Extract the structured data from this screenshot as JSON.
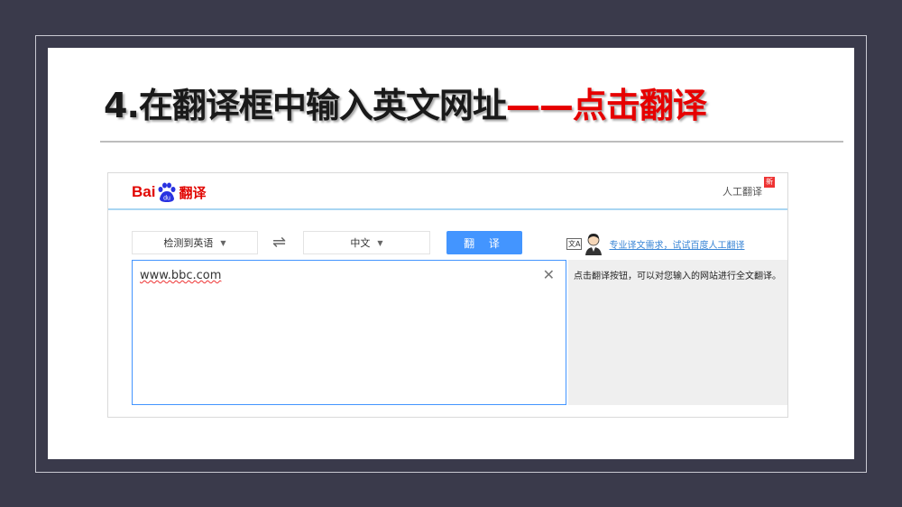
{
  "slide": {
    "title_part1": "4.在翻译框中输入英文网址",
    "title_part2": "——点击翻译"
  },
  "app": {
    "logo_text_bai": "Bai",
    "logo_text_du": "du",
    "logo_text_fanyi": "翻译",
    "human_translation_label": "人工翻译",
    "new_badge": "新",
    "source_lang": "检测到英语",
    "target_lang": "中文",
    "swap_symbol": "⇌",
    "translate_button": "翻 译",
    "input_value": "www.bbc.com",
    "clear_symbol": "✕",
    "promo_icon": "文A",
    "promo_link": "专业译文需求，试试百度人工翻译",
    "output_text": "点击翻译按钮，可以对您输入的网站进行全文翻译。"
  },
  "colors": {
    "background": "#3a3a4b",
    "title_red": "#e60000",
    "accent_blue": "#4395ff",
    "baidu_red": "#e10602"
  }
}
